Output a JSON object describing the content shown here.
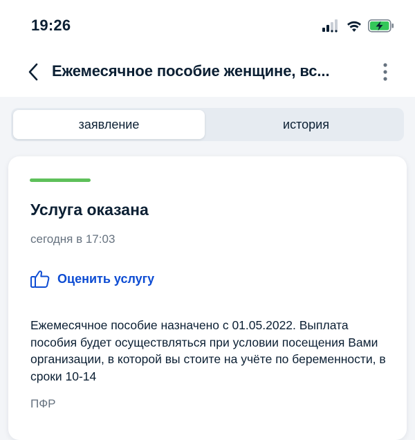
{
  "status_bar": {
    "time": "19:26",
    "icons": [
      "signal-icon",
      "wifi-icon",
      "battery-charging-icon"
    ]
  },
  "header": {
    "title": "Ежемесячное пособие женщине, вс..."
  },
  "tabs": [
    {
      "label": "заявление",
      "active": true
    },
    {
      "label": "история",
      "active": false
    }
  ],
  "card": {
    "status_color": "#5ec05a",
    "title": "Услуга оказана",
    "time": "сегодня в 17:03",
    "rate_label": "Оценить услугу",
    "body": "Ежемесячное пособие назначено с 01.05.2022. Выплата пособия будет осуществляться при условии посещения Вами организации, в которой вы стоите на учёте по беременности, в сроки 10-14",
    "source": "ПФР"
  },
  "colors": {
    "accent": "#0d4cd3",
    "text": "#0b1f33",
    "secondary_text": "#66727f",
    "background": "#f3f5f8"
  }
}
